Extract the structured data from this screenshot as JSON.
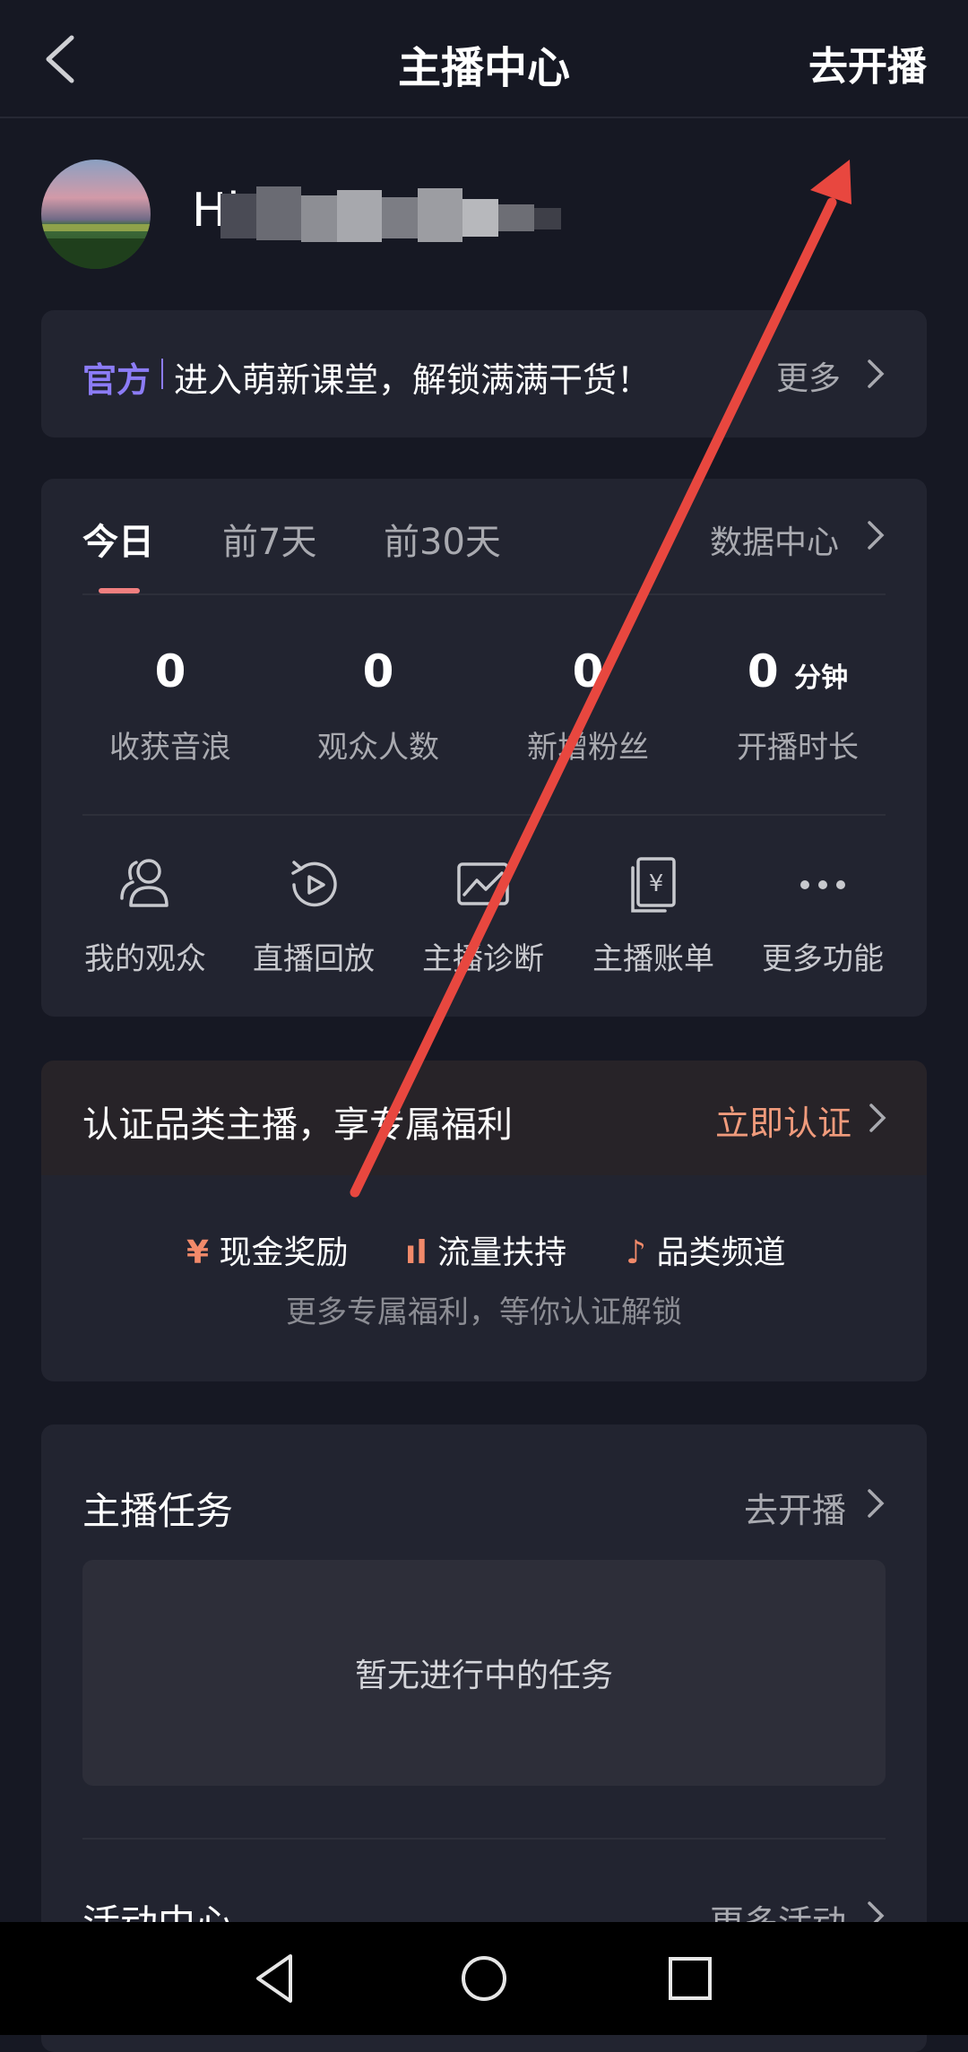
{
  "header": {
    "title": "主播中心",
    "go_live": "去开播"
  },
  "profile": {
    "username": "Hi"
  },
  "official": {
    "tag": "官方",
    "text": "进入萌新课堂，解锁满满干货！",
    "more": "更多"
  },
  "stats": {
    "tabs": [
      "今日",
      "前7天",
      "前30天"
    ],
    "data_center": "数据中心",
    "items": [
      {
        "value": "0",
        "unit": "",
        "label": "收获音浪"
      },
      {
        "value": "0",
        "unit": "",
        "label": "观众人数"
      },
      {
        "value": "0",
        "unit": "",
        "label": "新增粉丝"
      },
      {
        "value": "0",
        "unit": "分钟",
        "label": "开播时长"
      }
    ]
  },
  "functions": [
    {
      "label": "我的观众",
      "icon": "audience-icon"
    },
    {
      "label": "直播回放",
      "icon": "replay-icon"
    },
    {
      "label": "主播诊断",
      "icon": "diagnosis-icon"
    },
    {
      "label": "主播账单",
      "icon": "bill-icon"
    },
    {
      "label": "更多功能",
      "icon": "more-icon"
    }
  ],
  "certification": {
    "title": "认证品类主播，享专属福利",
    "link": "立即认证",
    "benefits": [
      {
        "icon": "¥",
        "label": "现金奖励"
      },
      {
        "icon": "ıl",
        "label": "流量扶持"
      },
      {
        "icon": "♪",
        "label": "品类频道"
      }
    ],
    "subtitle": "更多专属福利，等你认证解锁"
  },
  "tasks": {
    "title": "主播任务",
    "link": "去开播",
    "empty": "暂无进行中的任务"
  },
  "activity": {
    "title": "活动中心",
    "link": "更多活动"
  },
  "colors": {
    "background": "#161823",
    "card": "#222430",
    "accent_purple": "#8c7cf7",
    "accent_orange": "#f09b7c",
    "annotation_arrow": "#e8473f"
  }
}
